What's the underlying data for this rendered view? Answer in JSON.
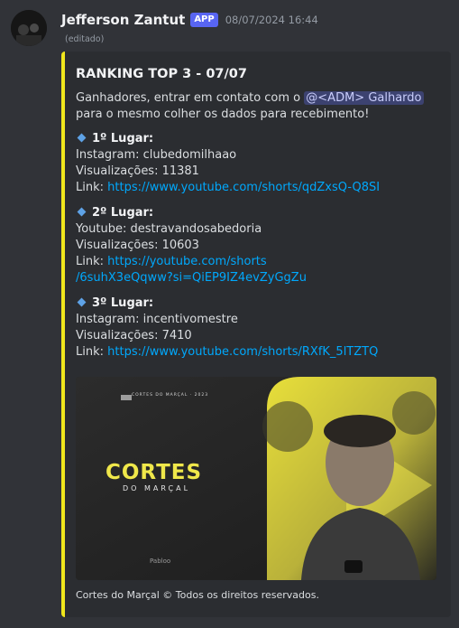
{
  "author": {
    "name": "Jefferson Zantut",
    "badge": "APP",
    "timestamp": "08/07/2024 16:44",
    "edited": "(editado)"
  },
  "embed": {
    "accent_color": "#f0e61c",
    "title": "RANKING TOP 3 - 07/07",
    "intro_before": "Ganhadores, entrar em contato com o ",
    "mention": "@<ADM> Galhardo",
    "intro_after": " para o mesmo colher os dados para recebimento!",
    "places": [
      {
        "title": "1º Lugar:",
        "line1": "Instagram: clubedomilhaao",
        "line2": "Visualizações: 11381",
        "link_label": "Link: ",
        "link": "https://www.youtube.com/shorts/qdZxsQ-Q8SI"
      },
      {
        "title": "2º Lugar:",
        "line1": "Youtube: destravandosabedoria",
        "line2": "Visualizações: 10603",
        "link_label": "Link: ",
        "link_part1": "https://youtube.com/shorts",
        "link_part2": "/6suhX3eQqww?si=QiEP9IZ4evZyGgZu"
      },
      {
        "title": "3º Lugar:",
        "line1": "Instagram: incentivomestre",
        "line2": "Visualizações: 7410",
        "link_label": "Link: ",
        "link": "https://www.youtube.com/shorts/RXfK_5lTZTQ"
      }
    ],
    "banner": {
      "small_header": "CORTES DO MARÇAL · 2023",
      "brand_big": "CORTES",
      "brand_sub": "DO MARÇAL",
      "credit": "Pabloo"
    },
    "footer": "Cortes do Marçal © Todos os direitos reservados."
  }
}
